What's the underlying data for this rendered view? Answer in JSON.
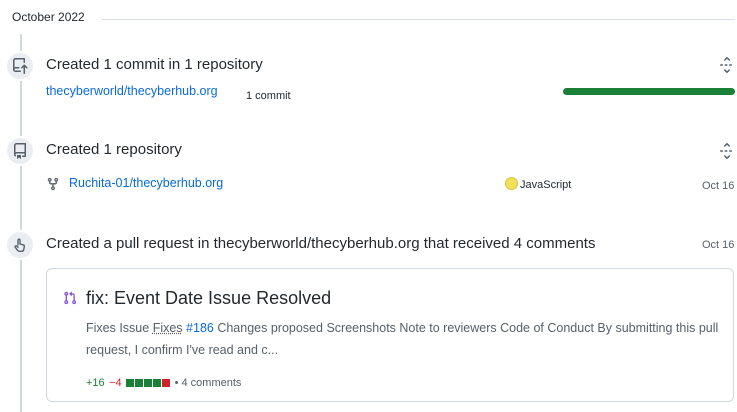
{
  "timeline": {
    "month_label": "October 2022"
  },
  "commit_item": {
    "title": "Created 1 commit in 1 repository",
    "repo": "thecyberworld/thecyberhub.org",
    "commit_count": "1 commit",
    "commit_share": 1.0
  },
  "repo_item": {
    "title": "Created 1 repository",
    "repo": "Ruchita-01/thecyberhub.org",
    "language": "JavaScript",
    "language_color": "#f1e05a",
    "date": "Oct 16"
  },
  "pr_item": {
    "title": "Created a pull request in thecyberworld/thecyberhub.org that received 4 comments",
    "date": "Oct 16",
    "card": {
      "title": "fix: Event Date Issue Resolved",
      "body_pre": "Fixes Issue ",
      "body_link1": "Fixes",
      "body_space": " ",
      "body_issue": "#186",
      "body_post": " Changes proposed Screenshots Note to reviewers Code of Conduct By submitting this pull request, I confirm I've read and c...",
      "additions": "+16",
      "deletions": "−4",
      "diff_squares": [
        "green",
        "green",
        "green",
        "green",
        "red"
      ],
      "comments": "• 4 comments"
    }
  },
  "colors": {
    "accent": "#0969da",
    "success": "#1a7f37",
    "danger": "#cf222e",
    "pr_icon": "#8250df"
  }
}
